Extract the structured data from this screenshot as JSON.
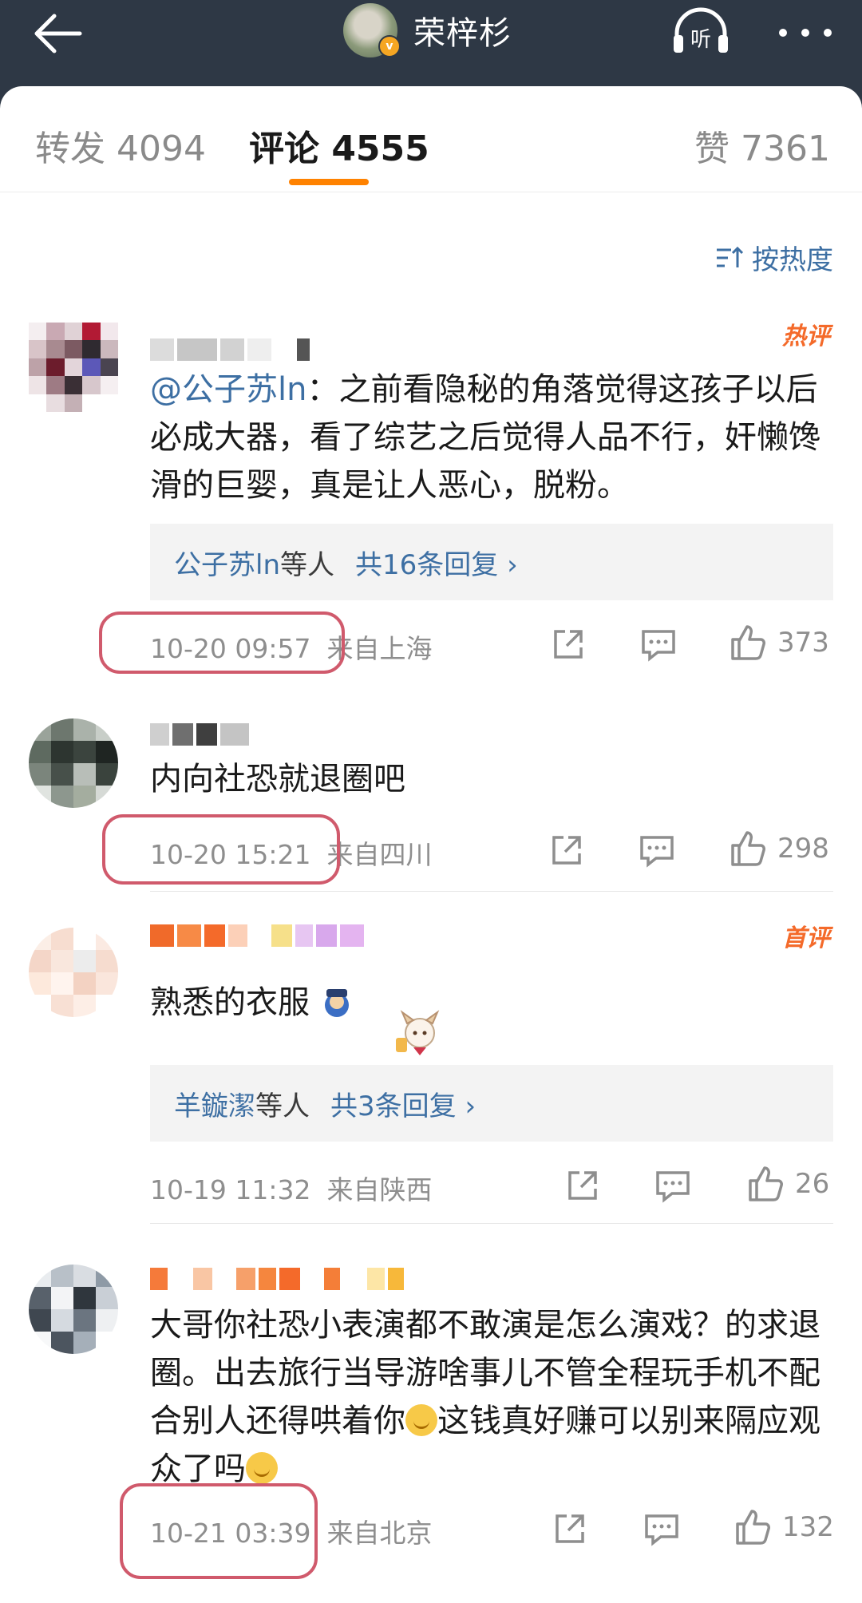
{
  "header": {
    "name": "荣梓杉",
    "verified_mark": "v",
    "listen_label": "听"
  },
  "tabs": {
    "repost": "转发 4094",
    "comments": "评论 4555",
    "likes": "赞 7361"
  },
  "sort": {
    "label": "按热度"
  },
  "comments": [
    {
      "badge": "热评",
      "mention": "@公子苏ln",
      "text": "：之前看隐秘的角落觉得这孩子以后必成大器，看了综艺之后觉得人品不行，奸懒馋滑的巨婴，真是让人恶心，脱粉。",
      "replies": {
        "user": "公子苏ln",
        "suffix": "等人",
        "count": "共16条回复 ›"
      },
      "time": "10-20 09:57",
      "location": "来自上海",
      "likes": "373"
    },
    {
      "text": "内向社恐就退圈吧",
      "time": "10-20 15:21",
      "location": "来自四川",
      "likes": "298"
    },
    {
      "badge": "首评",
      "text": "熟悉的衣服",
      "replies": {
        "user": "羊鏇潔",
        "suffix": "等人",
        "count": "共3条回复 ›"
      },
      "time": "10-19 11:32",
      "location": "来自陕西",
      "likes": "26"
    },
    {
      "text_a": "大哥你社恐小表演都不敢演是怎么演戏？的求退圈。出去旅行当导游啥事儿不管全程玩手机不配合别人还得哄着你",
      "text_b": "这钱真好赚可以别来隔应观众了吗",
      "time": "10-21 03:39",
      "location": "来自北京",
      "likes": "132"
    }
  ],
  "colors": {
    "header_bg": "#2e3845",
    "accent_orange": "#ff8200",
    "link_blue": "#3d6fa3",
    "highlight_circle": "#d05a6c"
  }
}
